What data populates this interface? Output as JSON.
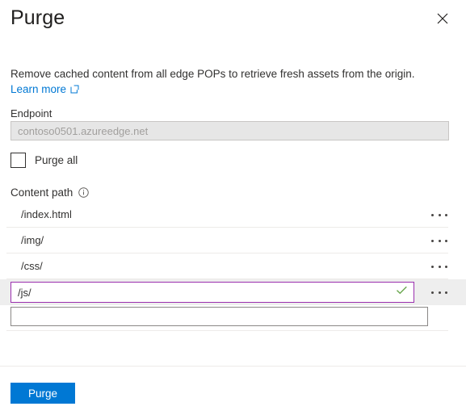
{
  "panel": {
    "title": "Purge",
    "close_label": "Close"
  },
  "description": {
    "text": "Remove cached content from all edge POPs to retrieve fresh assets from the origin.",
    "link_label": "Learn more"
  },
  "endpoint": {
    "label": "Endpoint",
    "value": "contoso0501.azureedge.net",
    "placeholder": "contoso0501.azureedge.net",
    "disabled": true
  },
  "purge_all": {
    "label": "Purge all",
    "checked": false
  },
  "content_path": {
    "label": "Content path",
    "info_tooltip": "Content path",
    "rows": [
      {
        "value": "/index.html",
        "state": "static"
      },
      {
        "value": "/img/",
        "state": "static"
      },
      {
        "value": "/css/",
        "state": "static"
      },
      {
        "value": "/js/",
        "state": "editing"
      }
    ],
    "new_row": {
      "value": "",
      "placeholder": ""
    },
    "menu_label": "More options"
  },
  "footer": {
    "purge_label": "Purge"
  },
  "colors": {
    "accent": "#0078d4",
    "link": "#0078d4",
    "active_border": "#9b2fae",
    "valid_check": "#6aa84f",
    "row_hover_bg": "#eeeeee",
    "disabled_bg": "#e6e6e6",
    "divider": "#edebe9",
    "text": "#323130"
  },
  "icons": {
    "close": "close-icon",
    "external_link": "external-link-icon",
    "info": "info-icon",
    "ellipsis": "ellipsis-icon",
    "check": "check-icon"
  }
}
